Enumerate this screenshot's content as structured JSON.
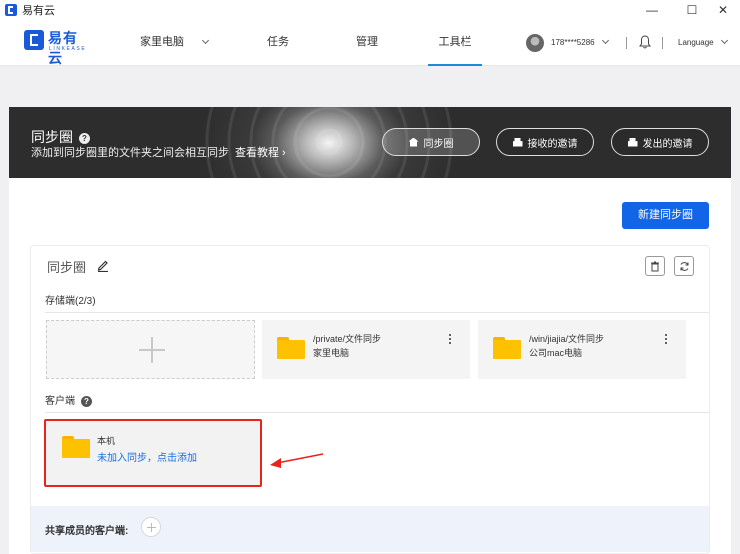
{
  "window": {
    "title": "易有云"
  },
  "logo": {
    "name": "易有云",
    "tagline": "LINKEASE"
  },
  "nav": {
    "items": [
      {
        "label": "家里电脑",
        "has_dropdown": true
      },
      {
        "label": "任务"
      },
      {
        "label": "管理"
      },
      {
        "label": "工具栏",
        "active": true
      }
    ],
    "user": "178****5286",
    "language": "Language"
  },
  "banner": {
    "title": "同步圈",
    "description": "添加到同步圈里的文件夹之间会相互同步",
    "tutorial": "查看教程 ›",
    "buttons": [
      {
        "label": "同步圈",
        "icon": "home-icon",
        "active": true
      },
      {
        "label": "接收的邀请",
        "icon": "inbox-icon"
      },
      {
        "label": "发出的邀请",
        "icon": "outbox-icon"
      }
    ]
  },
  "toolbar": {
    "new_label": "新建同步圈"
  },
  "circle": {
    "name": "同步圈",
    "storage_label": "存储端(2/3)",
    "storage_items": [
      {
        "path": "/private/文件同步",
        "device": "家里电脑"
      },
      {
        "path": "/win/jiajia/文件同步",
        "device": "公司mac电脑"
      }
    ],
    "client_label": "客户端",
    "client": {
      "name": "本机",
      "action": "未加入同步，点击添加"
    },
    "members_label": "共享成员的客户端:"
  },
  "colors": {
    "primary": "#1165e6",
    "highlight": "#e8231b",
    "folder": "#fdc100"
  }
}
